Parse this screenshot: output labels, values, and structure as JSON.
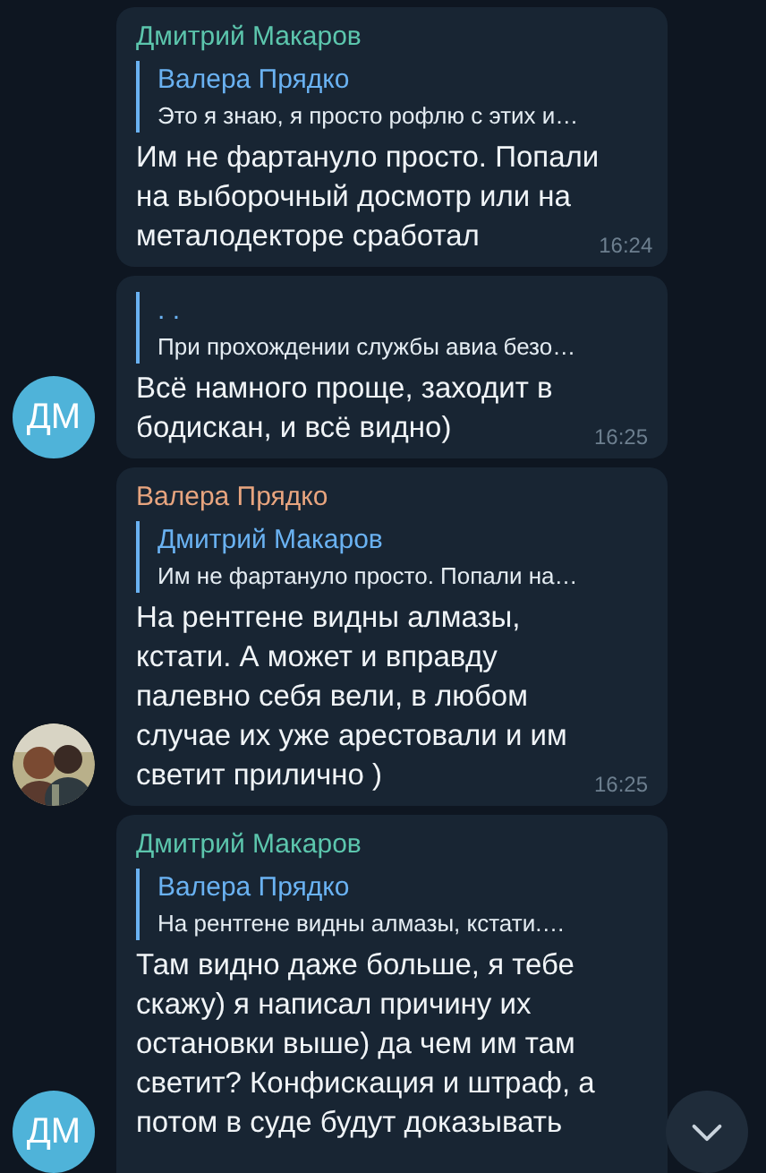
{
  "messages": [
    {
      "sender": {
        "name": "Дмитрий Макаров",
        "color": "#5cc6ad"
      },
      "reply": {
        "name": "Валера Прядко",
        "text": "Это я знаю, я просто рофлю с этих и…"
      },
      "lines": [
        "Им не фартануло просто. Попали",
        "на выборочный досмотр или на",
        "металодекторе сработал"
      ],
      "time": "16:24"
    },
    {
      "reply": {
        "name": ". .",
        "text": "При прохождении службы авиа безо…"
      },
      "lines": [
        "Всё намного проще, заходит в",
        "бодискан, и всё видно)"
      ],
      "time": "16:25",
      "avatar": {
        "kind": "initials",
        "text": "ДМ",
        "color": "#4fb3d9"
      }
    },
    {
      "sender": {
        "name": "Валера Прядко",
        "color": "#e8a57f"
      },
      "reply": {
        "name": "Дмитрий Макаров",
        "text": "Им не фартануло просто. Попали на…"
      },
      "lines": [
        "На рентгене видны алмазы,",
        "кстати. А может и вправду",
        "палевно себя вели, в любом",
        "случае их уже арестовали и им",
        "светит прилично )"
      ],
      "time": "16:25"
    },
    {
      "sender": {
        "name": "Дмитрий Макаров",
        "color": "#5cc6ad"
      },
      "reply": {
        "name": "Валера Прядко",
        "text": "На рентгене видны алмазы, кстати.…"
      },
      "lines": [
        "Там видно даже больше, я тебе",
        "скажу) я написал причину их",
        "остановки выше) да чем им там",
        "светит? Конфискация и штраф, а",
        "потом в суде будут доказывать"
      ],
      "avatar": {
        "kind": "initials",
        "text": "ДМ",
        "color": "#4fb3d9"
      }
    }
  ]
}
